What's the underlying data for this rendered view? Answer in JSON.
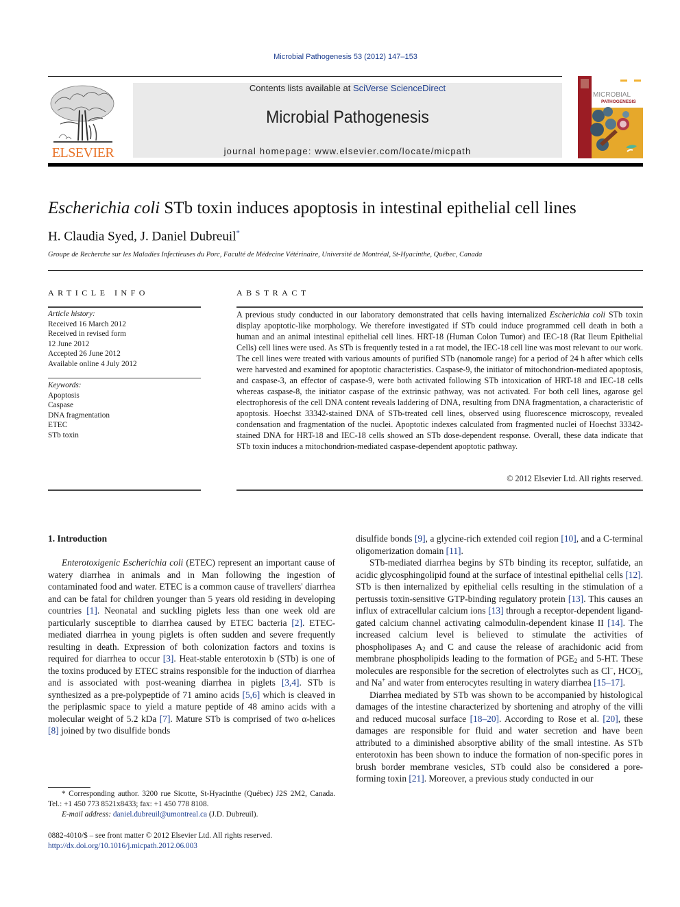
{
  "journal_citation": "Microbial Pathogenesis 53 (2012) 147–153",
  "header": {
    "publisher": "ELSEVIER",
    "contents_prefix": "Contents lists available at ",
    "contents_link": "SciVerse ScienceDirect",
    "journal_title": "Microbial Pathogenesis",
    "homepage": "journal homepage: www.elsevier.com/locate/micpath",
    "cover_title_line1": "MICROBIAL",
    "cover_title_line2": "PATHOGENESIS"
  },
  "article": {
    "title_italic": "Escherichia coli",
    "title_rest": " STb toxin induces apoptosis in intestinal epithelial cell lines",
    "authors": "H. Claudia Syed, J. Daniel Dubreuil",
    "author_mark": "*",
    "affiliation": "Groupe de Recherche sur les Maladies Infectieuses du Porc, Faculté de Médecine Vétérinaire, Université de Montréal, St-Hyacinthe, Québec, Canada"
  },
  "article_info": {
    "heading": "ARTICLE INFO",
    "history_label": "Article history:",
    "history": [
      "Received 16 March 2012",
      "Received in revised form",
      "12 June 2012",
      "Accepted 26 June 2012",
      "Available online 4 July 2012"
    ],
    "keywords_label": "Keywords:",
    "keywords": [
      "Apoptosis",
      "Caspase",
      "DNA fragmentation",
      "ETEC",
      "STb toxin"
    ]
  },
  "abstract": {
    "heading": "ABSTRACT",
    "part1": "A previous study conducted in our laboratory demonstrated that cells having internalized ",
    "italic1": "Escherichia coli",
    "part2": " STb toxin display apoptotic-like morphology. We therefore investigated if STb could induce programmed cell death in both a human and an animal intestinal epithelial cell lines. HRT-18 (Human Colon Tumor) and IEC-18 (Rat Ileum Epithelial Cells) cell lines were used. As STb is frequently tested in a rat model, the IEC-18 cell line was most relevant to our work. The cell lines were treated with various amounts of purified STb (nanomole range) for a period of 24 h after which cells were harvested and examined for apoptotic characteristics. Caspase-9, the initiator of mitochondrion-mediated apoptosis, and caspase-3, an effector of caspase-9, were both activated following STb intoxication of HRT-18 and IEC-18 cells whereas caspase-8, the initiator caspase of the extrinsic pathway, was not activated. For both cell lines, agarose gel electrophoresis of the cell DNA content reveals laddering of DNA, resulting from DNA frag­mentation, a characteristic of apoptosis. Hoechst 33342-stained DNA of STb-treated cell lines, observed using fluorescence microscopy, revealed condensation and fragmentation of the nuclei. Apoptotic indexes calculated from fragmented nuclei of Hoechst 33342-stained DNA for HRT-18 and IEC-18 cells showed an STb dose-dependent response. Overall, these data indicate that STb toxin induces a mito­chondrion-mediated caspase-dependent apoptotic pathway.",
    "copyright": "© 2012 Elsevier Ltd. All rights reserved."
  },
  "introduction": {
    "heading": "1.  Introduction",
    "p1": {
      "i1": "Enterotoxigenic Escherichia coli",
      "t1": " (ETEC) represent an important cause of watery diarrhea in animals and in Man following the ingestion of contaminated food and water. ETEC is a common cause of travellers' diarrhea and can be fatal for children younger than 5 years old residing in developing countries ",
      "r1": "[1]",
      "t2": ". Neonatal and suck­ling piglets less than one week old are particularly susceptible to diarrhea caused by ETEC bacteria ",
      "r2": "[2]",
      "t3": ". ETEC-mediated diarrhea in young piglets is often sudden and severe frequently resulting in death. Expression of both colonization factors and toxins is required for diarrhea to occur ",
      "r3": "[3]",
      "t4": ". Heat-stable enterotoxin b (STb) is one of the toxins produced by ETEC strains responsible for the induction of diarrhea and is associated with post-weaning diarrhea in piglets ",
      "r4": "[3,4]",
      "t5": ". STb is synthesized as a pre-polypeptide of 71 amino acids ",
      "r5": "[5,6]",
      "t6": " which is cleaved in the periplasmic space to yield a mature peptide of 48 amino acids with a molecular weight of 5.2 kDa ",
      "r6": "[7]",
      "t7": ". Mature STb is comprised of two α-helices ",
      "r7": "[8]",
      "t8": " joined by two disulfide bonds ",
      "r8": "[9]",
      "t9": ", a glycine-rich extended coil region ",
      "r9": "[10]",
      "t10": ", and a C-terminal oligomerization domain ",
      "r10": "[11]",
      "t11": "."
    },
    "p2": {
      "t1": "STb-mediated diarrhea begins by STb binding its receptor, sul­fatide, an acidic glycosphingolipid found at the surface of intestinal epithelial cells ",
      "r1": "[12]",
      "t2": ". STb is then internalized by epithelial cells resulting in the stimulation of a pertussis toxin-sensitive GTP-binding regulatory protein ",
      "r2": "[13]",
      "t3": ". This causes an influx of extracel­lular calcium ions ",
      "r3": "[13]",
      "t4": " through a receptor-dependent ligand-gated calcium channel activating calmodulin-dependent kinase II ",
      "r4": "[14]",
      "t5": ". The increased calcium level is believed to stimulate the activities of phospholipases A",
      "s1": "2",
      "t6": " and C and cause the release of arachidonic acid from membrane phospholipids leading to the formation of PGE",
      "s2": "2",
      "t7": " and 5-HT. These molecules are responsible for the secretion of electrolytes such as Cl",
      "sup1": "−",
      "t8": ", HCO",
      "s3": "3",
      "sup2": "−",
      "t9": ", and Na",
      "sup3": "+",
      "t10": " and water from enterocytes resulting in watery diarrhea ",
      "r5": "[15–17]",
      "t11": "."
    },
    "p3": {
      "t1": "Diarrhea mediated by STb was shown to be accompanied by histological damages of the intestine characterized by shortening and atrophy of the villi and reduced mucosal surface ",
      "r1": "[18–20]",
      "t2": ". According to Rose et al. ",
      "r2": "[20]",
      "t3": ", these damages are responsible for fluid and water secretion and have been attributed to a diminished absorptive ability of the small intestine. As STb enterotoxin has been shown to induce the formation of non-specific pores in brush border membrane vesicles, STb could also be considered a pore-forming toxin ",
      "r3": "[21]",
      "t4": ". Moreover, a previous study conducted in our"
    }
  },
  "footnote": {
    "text": "* Corresponding author. 3200 rue Sicotte, St-Hyacinthe (Québec) J2S 2M2, Canada. Tel.: +1 450 773 8521x8433; fax: +1 450 778 8108.",
    "email_label": "E-mail address:",
    "email": "daniel.dubreuil@umontreal.ca",
    "email_suffix": " (J.D. Dubreuil)."
  },
  "front_matter": {
    "issn": "0882-4010/$ – see front matter © 2012 Elsevier Ltd. All rights reserved.",
    "doi": "http://dx.doi.org/10.1016/j.micpath.2012.06.003"
  },
  "colors": {
    "link": "#1c3d8f",
    "elsevier_orange": "#e8742a",
    "header_box": "#eaeaea"
  }
}
